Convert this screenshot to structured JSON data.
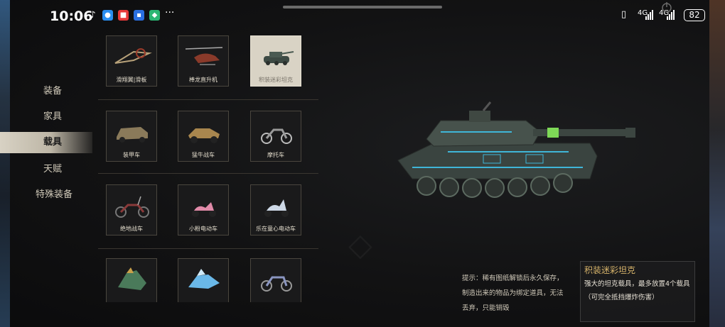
{
  "status_bar": {
    "time": "10:06",
    "icons": [
      "tiktok-icon",
      "chat-icon",
      "app-icon",
      "app-icon-2",
      "shield-icon"
    ],
    "more": "···",
    "network1": "4G",
    "network2": "4G",
    "battery": "82"
  },
  "menu": {
    "items": [
      {
        "label": "装备"
      },
      {
        "label": "家具"
      },
      {
        "label": "载具"
      },
      {
        "label": "天赋"
      },
      {
        "label": "特殊装备"
      }
    ],
    "active_index": 2
  },
  "grid": {
    "items": [
      {
        "label": "滑翔翼|滑板",
        "icon": "glider-icon"
      },
      {
        "label": "棒龙直升机",
        "icon": "helicopter-icon"
      },
      {
        "label": "积装迷彩坦克",
        "icon": "tank-icon"
      },
      {
        "label": "装甲车",
        "icon": "armored-car-icon"
      },
      {
        "label": "猛牛战车",
        "icon": "buggy-icon"
      },
      {
        "label": "摩托车",
        "icon": "motorcycle-icon"
      },
      {
        "label": "绝地战车",
        "icon": "chopper-bike-icon"
      },
      {
        "label": "小粉电动车",
        "icon": "pink-scooter-icon"
      },
      {
        "label": "乐在童心电动车",
        "icon": "scooter-icon"
      },
      {
        "label": "",
        "icon": "dragon-bike-icon"
      },
      {
        "label": "",
        "icon": "ice-bike-icon"
      },
      {
        "label": "",
        "icon": "classic-motorbike-icon"
      }
    ],
    "selected_index": 2
  },
  "tip": {
    "text": "提示：稀有图纸解锁后永久保存，制造出来的物品为绑定道具，无法丢弃，只能销毁"
  },
  "detail": {
    "title": "积装迷彩坦克",
    "description": "强大的坦克载具，最多放置4个载具（可完全抵挡爆炸伤害）"
  },
  "colors": {
    "title_gold": "#d6b36a",
    "tank_accent": "#3fb6d8",
    "barrel_green": "#7ed957"
  }
}
